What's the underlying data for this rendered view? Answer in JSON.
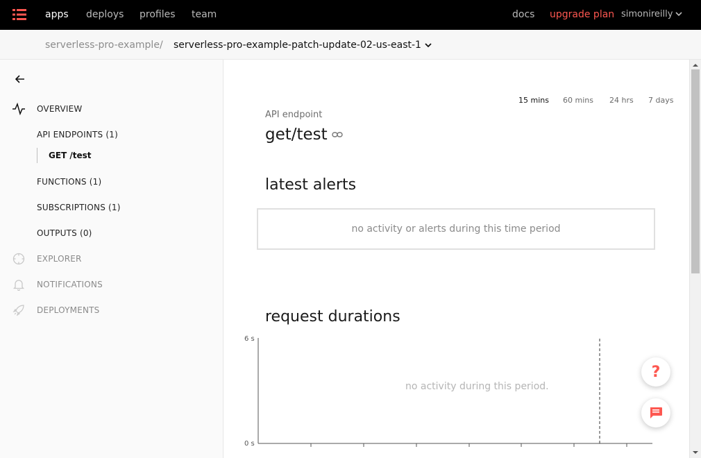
{
  "nav": {
    "items": [
      {
        "label": "apps",
        "active": true
      },
      {
        "label": "deploys",
        "active": false
      },
      {
        "label": "profiles",
        "active": false
      },
      {
        "label": "team",
        "active": false
      }
    ],
    "docs": "docs",
    "upgrade": "upgrade plan",
    "user": "simonireilly"
  },
  "breadcrumb": {
    "root": "serverless-pro-example",
    "separator": "/",
    "current": "serverless-pro-example-patch-update-02-us-east-1"
  },
  "sidebar": {
    "overview": "OVERVIEW",
    "api_endpoints": "API ENDPOINTS (1)",
    "endpoint_item": "GET /test",
    "functions": "FUNCTIONS (1)",
    "subscriptions": "SUBSCRIPTIONS (1)",
    "outputs": "OUTPUTS (0)",
    "explorer": "EXPLORER",
    "notifications": "NOTIFICATIONS",
    "deployments": "DEPLOYMENTS"
  },
  "main": {
    "ranges": [
      {
        "label": "15 mins",
        "active": true
      },
      {
        "label": "60 mins",
        "active": false
      },
      {
        "label": "24 hrs",
        "active": false
      },
      {
        "label": "7 days",
        "active": false
      }
    ],
    "subtitle": "API endpoint",
    "title": "get/test",
    "alerts_title": "latest alerts",
    "alerts_empty": "no activity or alerts during this time period",
    "durations_title": "request durations",
    "durations_empty": "no activity during this period."
  },
  "chart_data": {
    "type": "line",
    "title": "request durations",
    "ylim": [
      0,
      6
    ],
    "ytick_labels": [
      "6 s",
      "0 s"
    ],
    "series": [],
    "grid": false
  },
  "colors": {
    "accent": "#fd5750",
    "topbar": "#000000"
  }
}
